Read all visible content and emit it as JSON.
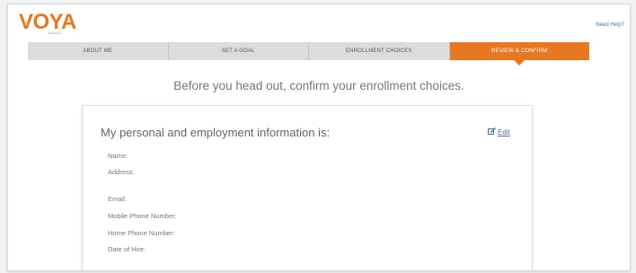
{
  "header": {
    "logo_text": "VOYA",
    "logo_subtext": "FINANCIAL",
    "need_help": "Need Help?",
    "brand_color": "#e87722"
  },
  "tabs": [
    {
      "label": "ABOUT ME",
      "active": false
    },
    {
      "label": "SET A GOAL",
      "active": false
    },
    {
      "label": "ENROLLMENT CHOICES",
      "active": false
    },
    {
      "label": "REVIEW & CONFIRM",
      "active": true
    }
  ],
  "main": {
    "headline": "Before you head out, confirm your enrollment choices."
  },
  "card": {
    "title": "My personal and employment information is:",
    "edit_label": "Edit",
    "edit_icon": "edit-icon",
    "fields": [
      "Name:",
      "Address:",
      "Email:",
      "Mobile Phone Number:",
      "Home Phone Number:",
      "Date of Hire:"
    ]
  }
}
